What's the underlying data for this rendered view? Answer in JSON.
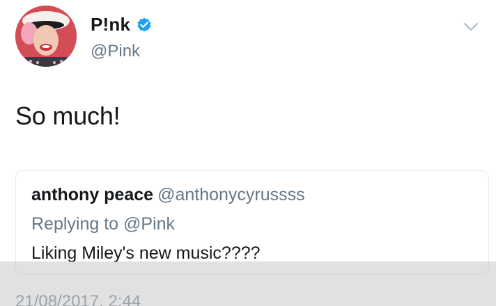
{
  "tweet": {
    "author": {
      "display_name": "P!nk",
      "handle": "@Pink",
      "verified": true,
      "avatar_icon": "avatar-photo"
    },
    "text": "So much!",
    "timestamp": "21/08/2017, 2:44",
    "menu_icon": "chevron-down-icon"
  },
  "quoted": {
    "display_name": "anthony peace",
    "handle": "@anthonycyrussss",
    "replying_label": "Replying to",
    "replying_handle": "@Pink",
    "text": "Liking Miley's new music????"
  },
  "colors": {
    "verified_blue": "#1da1f2",
    "secondary_text": "#657786",
    "primary_text": "#14171a",
    "border": "#e1e8ed"
  }
}
